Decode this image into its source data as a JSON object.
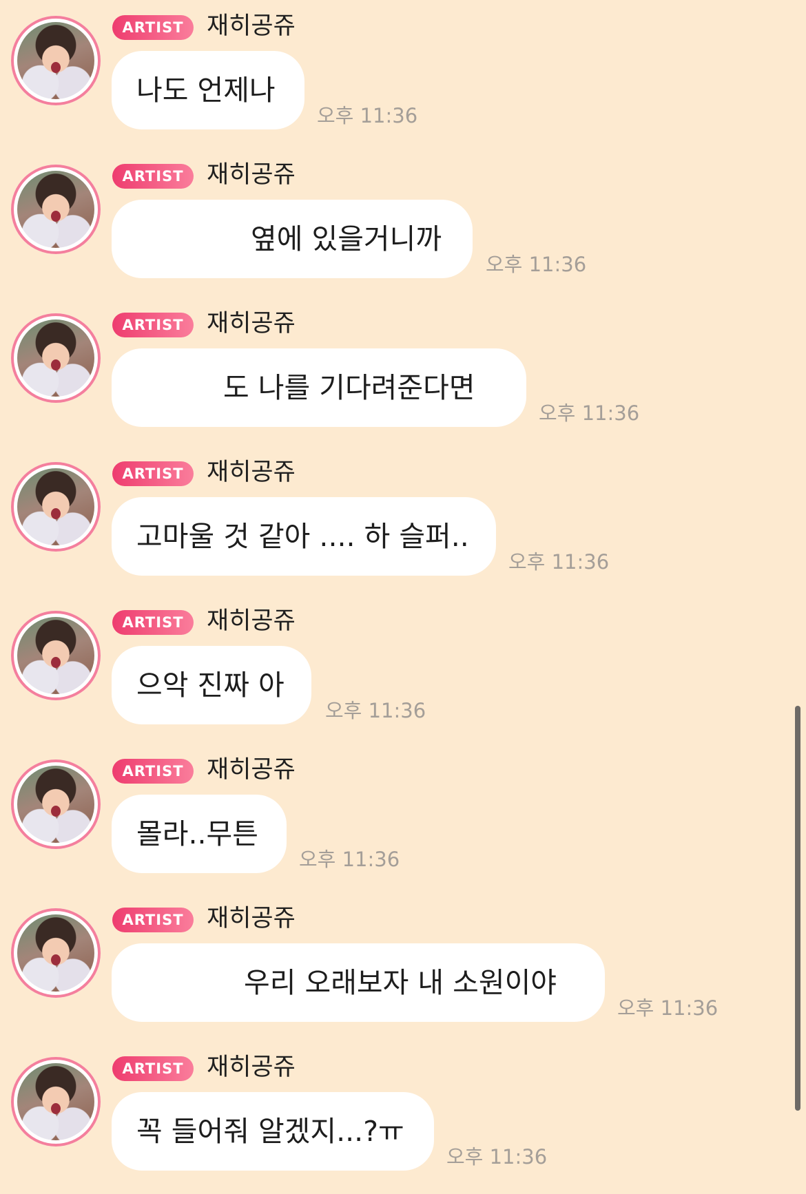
{
  "messages": [
    {
      "badge": "ARTIST",
      "sender": "재히공쥬",
      "text": "나도 언제나",
      "time": "오후 11:36",
      "redacted": false
    },
    {
      "badge": "ARTIST",
      "sender": "재히공쥬",
      "text": "옆에 있을거니까",
      "time": "오후 11:36",
      "redacted": true
    },
    {
      "badge": "ARTIST",
      "sender": "재히공쥬",
      "text": "도 나를 기다려준다면",
      "time": "오후 11:36",
      "redacted": true
    },
    {
      "badge": "ARTIST",
      "sender": "재히공쥬",
      "text": "고마울 것 같아 .... 하 슬퍼..",
      "time": "오후 11:36",
      "redacted": false
    },
    {
      "badge": "ARTIST",
      "sender": "재히공쥬",
      "text": "으악 진짜 아",
      "time": "오후 11:36",
      "redacted": false
    },
    {
      "badge": "ARTIST",
      "sender": "재히공쥬",
      "text": "몰라..무튼",
      "time": "오후 11:36",
      "redacted": false
    },
    {
      "badge": "ARTIST",
      "sender": "재히공쥬",
      "text": "우리 오래보자 내 소원이야",
      "time": "오후 11:36",
      "redacted": true
    },
    {
      "badge": "ARTIST",
      "sender": "재히공쥬",
      "text": "꼭 들어줘 알겠지...?ㅠ",
      "time": "오후 11:36",
      "redacted": false
    }
  ],
  "theme": {
    "background": "#fdead0",
    "bubble": "#ffffff",
    "badge_gradient": [
      "#ee3d6f",
      "#fa7d9b"
    ],
    "avatar_ring": "#f47f9d",
    "time_color": "#a49e98"
  },
  "icons": {
    "avatar": "artist-avatar-photo"
  }
}
